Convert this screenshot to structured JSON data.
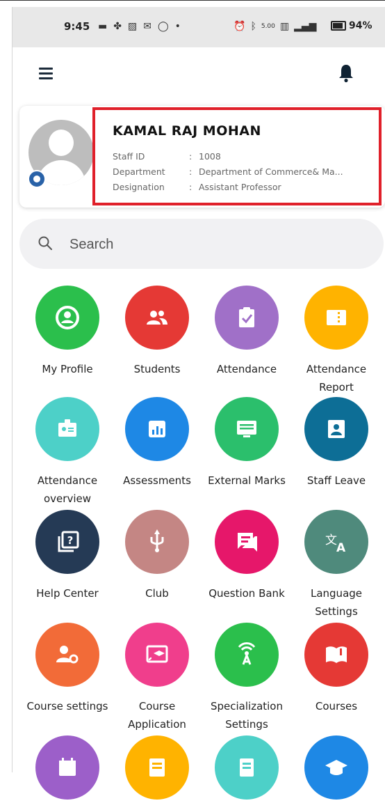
{
  "status_bar": {
    "time": "9:45",
    "icons_left": [
      "video-icon",
      "fan-icon",
      "image-icon",
      "mail-icon",
      "circle-icon",
      "dot-icon"
    ],
    "icons_right": [
      "alarm-icon",
      "bluetooth-icon",
      "data-speed-icon",
      "network-icon",
      "signal-icon"
    ],
    "data_speed_text": "5.00",
    "battery": "94%"
  },
  "app_bar": {
    "menu_icon": "hamburger-menu-icon",
    "notification_icon": "bell-icon"
  },
  "profile": {
    "name": "KAMAL RAJ MOHAN",
    "rows": [
      {
        "label": "Staff ID",
        "colon": ":",
        "value": "1008"
      },
      {
        "label": "Department",
        "colon": ":",
        "value": "Department of Commerce& Ma..."
      },
      {
        "label": "Designation",
        "colon": ":",
        "value": "Assistant Professor"
      }
    ],
    "highlight_color": "#e0202a"
  },
  "search": {
    "placeholder": "Search",
    "value": ""
  },
  "menu": [
    {
      "label": "My Profile",
      "color": "#2bbf4c",
      "icon": "user-circle-icon"
    },
    {
      "label": "Students",
      "color": "#e53935",
      "icon": "group-icon"
    },
    {
      "label": "Attendance",
      "color": "#a070c8",
      "icon": "clipboard-check-icon"
    },
    {
      "label": "Attendance Report",
      "color": "#ffb300",
      "icon": "report-icon"
    },
    {
      "label": "Attendance overview",
      "color": "#4dd0c8",
      "icon": "id-badge-icon"
    },
    {
      "label": "Assessments",
      "color": "#1e88e5",
      "icon": "bar-chart-icon"
    },
    {
      "label": "External Marks",
      "color": "#2bbf6c",
      "icon": "monitor-icon"
    },
    {
      "label": "Staff Leave",
      "color": "#0d6e96",
      "icon": "contact-icon"
    },
    {
      "label": "Help Center",
      "color": "#253a55",
      "icon": "help-icon"
    },
    {
      "label": "Club",
      "color": "#c48684",
      "icon": "usb-icon"
    },
    {
      "label": "Question Bank",
      "color": "#e6176a",
      "icon": "chat-icon"
    },
    {
      "label": "Language Settings",
      "color": "#4f8a7c",
      "icon": "translate-icon"
    },
    {
      "label": "Course settings",
      "color": "#f26b38",
      "icon": "user-settings-icon"
    },
    {
      "label": "Course Application",
      "color": "#f03e8c",
      "icon": "cast-education-icon"
    },
    {
      "label": "Specialization Settings",
      "color": "#2bbf4c",
      "icon": "antenna-icon"
    },
    {
      "label": "Courses",
      "color": "#e53935",
      "icon": "book-icon"
    },
    {
      "label": "",
      "color": "#9c5fc9",
      "icon": "calendar-icon"
    },
    {
      "label": "",
      "color": "#ffb300",
      "icon": "list-icon"
    },
    {
      "label": "",
      "color": "#4dd0c8",
      "icon": "document-icon"
    },
    {
      "label": "",
      "color": "#1e88e5",
      "icon": "graduation-cap-icon"
    }
  ]
}
